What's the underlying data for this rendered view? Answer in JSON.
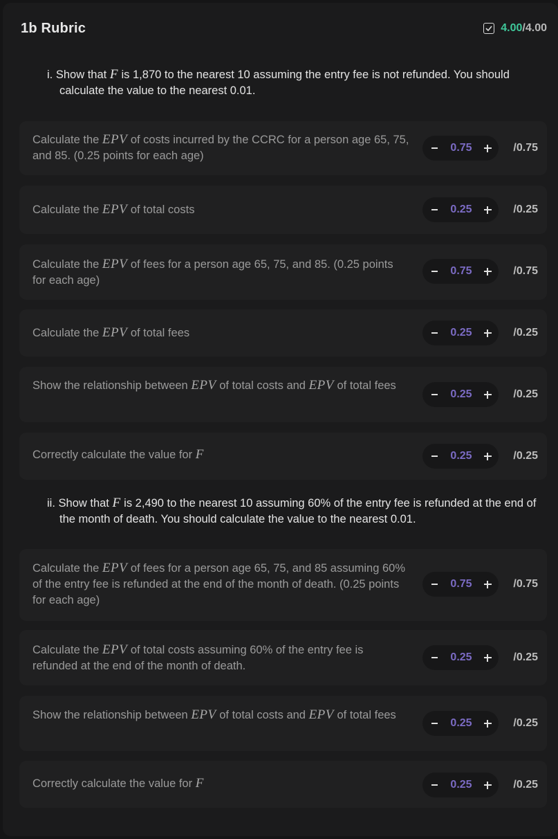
{
  "header": {
    "title": "1b Rubric",
    "score_earned": "4.00",
    "score_max": "/4.00",
    "check_icon": "checkbox-checked-icon",
    "score_color": "#3fc89a"
  },
  "questions": [
    {
      "label": "i.",
      "text_pre": "Show that ",
      "math": "F",
      "text_post": " is 1,870 to the nearest 10 assuming the entry fee is not refunded. You should calculate the value to the nearest 0.01."
    },
    {
      "label": "ii.",
      "text_pre": "Show that ",
      "math": "F",
      "text_post": " is 2,490 to the nearest 10 assuming 60% of the entry fee is refunded at the end of the month of death. You should calculate the value to the nearest 0.01."
    }
  ],
  "criteria": [
    {
      "p1": "Calculate the ",
      "m1": "EPV",
      "p2": " of costs incurred by the CCRC for a person age 65, 75, and 85. (0.25 points for each age)",
      "value": "0.75",
      "max": "/0.75"
    },
    {
      "p1": "Calculate the ",
      "m1": "EPV",
      "p2": " of total costs",
      "value": "0.25",
      "max": "/0.25"
    },
    {
      "p1": "Calculate the ",
      "m1": "EPV",
      "p2": " of fees for a person age 65, 75, and 85. (0.25 points for each age)",
      "value": "0.75",
      "max": "/0.75"
    },
    {
      "p1": "Calculate the ",
      "m1": "EPV",
      "p2": " of total fees",
      "value": "0.25",
      "max": "/0.25"
    },
    {
      "p1": "Show the relationship between ",
      "m1": "EPV",
      "p2": " of total costs and ",
      "m2": "EPV",
      "p3": " of total fees",
      "value": "0.25",
      "max": "/0.25"
    },
    {
      "p1": "Correctly calculate the value for ",
      "m1": "F",
      "p2": "",
      "value": "0.25",
      "max": "/0.25"
    },
    {
      "p1": "Calculate the ",
      "m1": "EPV",
      "p2": " of fees for a person age 65, 75, and 85 assuming 60% of the entry fee is refunded at the end of the month of death. (0.25 points for each age)",
      "value": "0.75",
      "max": "/0.75"
    },
    {
      "p1": "Calculate the ",
      "m1": "EPV",
      "p2": " of total costs assuming 60% of the entry fee is refunded at the end of the month of death.",
      "value": "0.25",
      "max": "/0.25"
    },
    {
      "p1": "Show the relationship between ",
      "m1": "EPV",
      "p2": " of total costs and ",
      "m2": "EPV",
      "p3": " of total fees",
      "value": "0.25",
      "max": "/0.25"
    },
    {
      "p1": "Correctly calculate the value for ",
      "m1": "F",
      "p2": "",
      "value": "0.25",
      "max": "/0.25"
    }
  ],
  "icons": {
    "decrement": "minus-icon",
    "increment": "plus-icon"
  },
  "colors": {
    "value_accent": "#7b6bc4",
    "earned_accent": "#3fc89a"
  }
}
